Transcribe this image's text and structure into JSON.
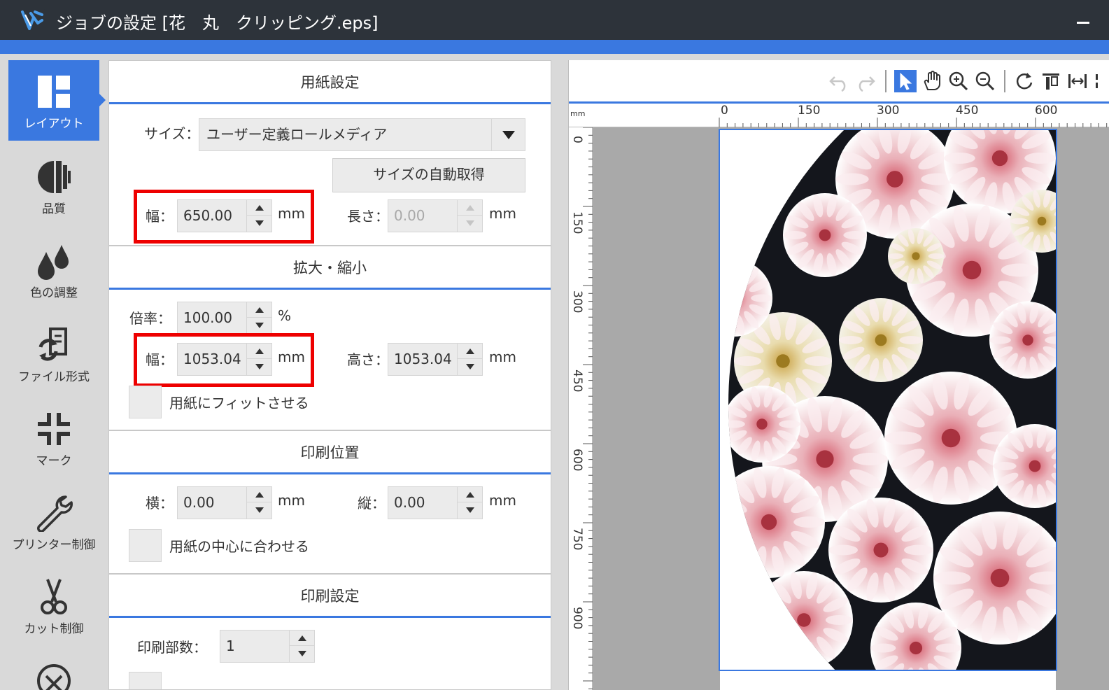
{
  "window": {
    "title": "ジョブの設定 [花　丸　クリッピング.eps]"
  },
  "sidebar": {
    "items": [
      {
        "label": "レイアウト",
        "icon": "layout-icon"
      },
      {
        "label": "品質",
        "icon": "quality-icon"
      },
      {
        "label": "色の調整",
        "icon": "color-adjust-icon"
      },
      {
        "label": "ファイル形式",
        "icon": "file-format-icon"
      },
      {
        "label": "マーク",
        "icon": "mark-icon"
      },
      {
        "label": "プリンター制御",
        "icon": "wrench-icon"
      },
      {
        "label": "カット制御",
        "icon": "scissors-icon"
      }
    ]
  },
  "paper": {
    "header": "用紙設定",
    "size_label": "サイズ：",
    "size_value": "ユーザー定義ロールメディア",
    "auto_size_button": "サイズの自動取得",
    "width_label": "幅：",
    "width_value": "650.00",
    "width_unit": "mm",
    "length_label": "長さ：",
    "length_value": "0.00",
    "length_unit": "mm"
  },
  "scale": {
    "header": "拡大・縮小",
    "ratio_label": "倍率：",
    "ratio_value": "100.00",
    "ratio_unit": "%",
    "width_label": "幅：",
    "width_value": "1053.04",
    "width_unit": "mm",
    "height_label": "高さ：",
    "height_value": "1053.04",
    "height_unit": "mm",
    "fit_label": "用紙にフィットさせる"
  },
  "position": {
    "header": "印刷位置",
    "h_label": "横：",
    "h_value": "0.00",
    "h_unit": "mm",
    "v_label": "縦：",
    "v_value": "0.00",
    "v_unit": "mm",
    "center_label": "用紙の中心に合わせる"
  },
  "print": {
    "header": "印刷設定",
    "copies_label": "印刷部数：",
    "copies_value": "1"
  },
  "preview": {
    "ruler_unit": "mm",
    "top_ticks": [
      "0",
      "150",
      "300",
      "450",
      "600"
    ],
    "left_ticks": [
      "0",
      "150",
      "300",
      "450",
      "600",
      "750",
      "900"
    ]
  },
  "colors": {
    "accent": "#3a78e0",
    "titlebar": "#2d333a",
    "highlight": "#ee0000"
  }
}
